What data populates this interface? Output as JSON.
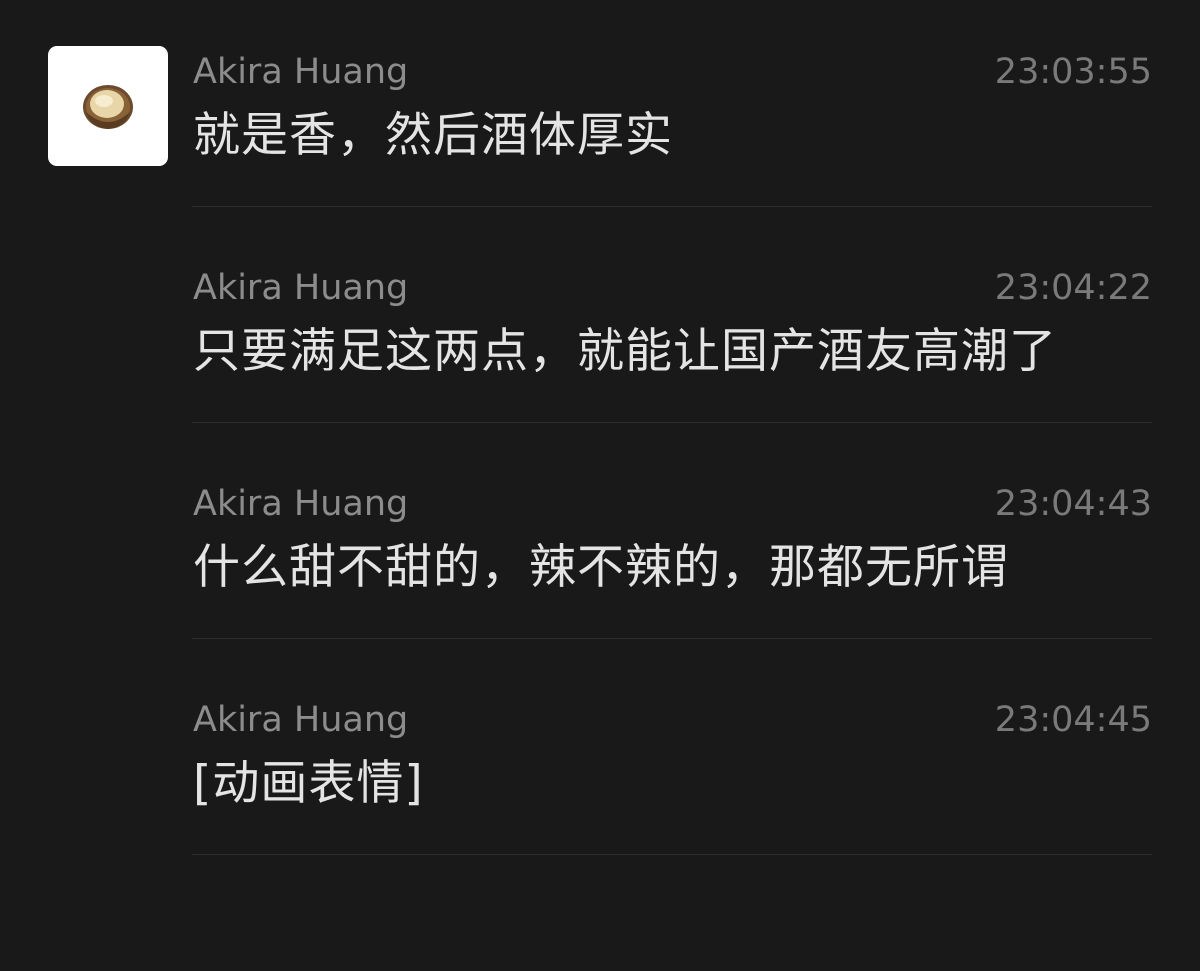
{
  "messages": [
    {
      "sender": "Akira Huang",
      "time": "23:03:55",
      "text": "就是香，然后酒体厚实",
      "has_avatar": true,
      "avatar_icon": "macadamia-nut-icon"
    },
    {
      "sender": "Akira Huang",
      "time": "23:04:22",
      "text": "只要满足这两点，就能让国产酒友高潮了",
      "has_avatar": false
    },
    {
      "sender": "Akira Huang",
      "time": "23:04:43",
      "text": "什么甜不甜的，辣不辣的，那都无所谓",
      "has_avatar": false
    },
    {
      "sender": "Akira Huang",
      "time": "23:04:45",
      "text": "[动画表情]",
      "has_avatar": false
    }
  ],
  "colors": {
    "background": "#191919",
    "sender": "#8c8c8c",
    "timestamp": "#7a7a7a",
    "message_text": "#e4e4e4",
    "divider": "#2d2d2d",
    "avatar_bg": "#ffffff"
  }
}
